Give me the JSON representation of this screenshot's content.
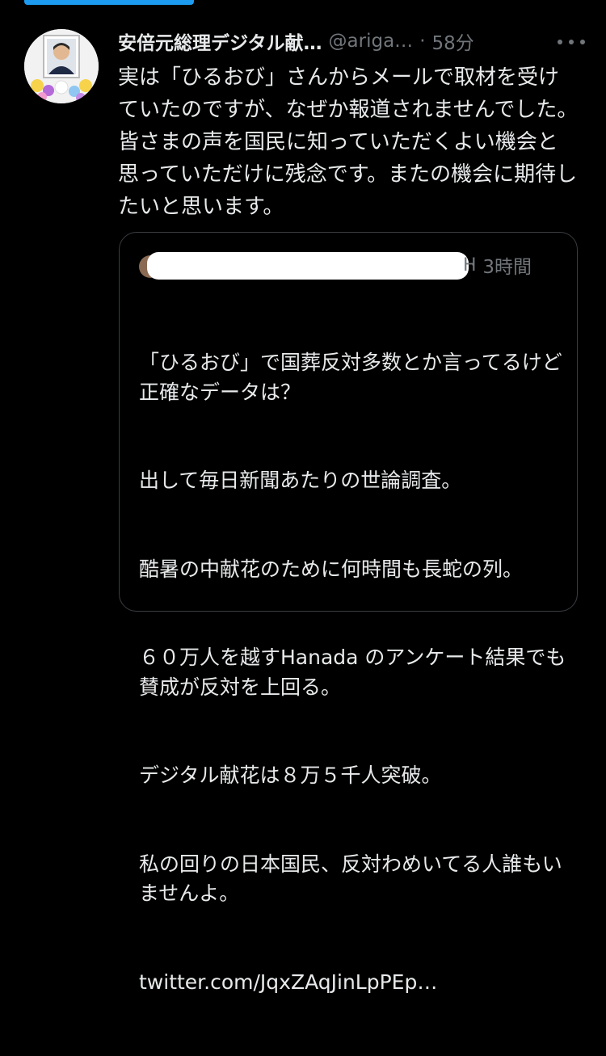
{
  "tweet": {
    "display_name": "安倍元総理デジタル献…",
    "handle": "@ariga…",
    "separator": "·",
    "timestamp": "58分",
    "more_icon": "more-horizontal-icon",
    "text": "実は「ひるおび」さんからメールで取材を受けていたのですが、なぜか報道されませんでした。皆さまの声を国民に知っていただくよい機会と思っていただけに残念です。またの機会に期待したいと思います。"
  },
  "quote": {
    "author_tail": "H",
    "separator": "·",
    "timestamp": "3時間",
    "lines": [
      "「ひるおび」で国葬反対多数とか言ってるけど正確なデータは？",
      "出して毎日新聞あたりの世論調査。",
      "酷暑の中献花のために何時間も長蛇の列。",
      "６０万人を越すHanada のアンケート結果でも賛成が反対を上回る。",
      "デジタル献花は８万５千人突破。",
      "私の回りの日本国民、反対わめいてる人誰もいませんよ。"
    ],
    "link": "twitter.com/JqxZAqJinLpPEp…"
  },
  "colors": {
    "background": "#000000",
    "text": "#e7e9ea",
    "secondary": "#71767b",
    "accent": "#1d9bf0",
    "border": "#3a3d41"
  }
}
